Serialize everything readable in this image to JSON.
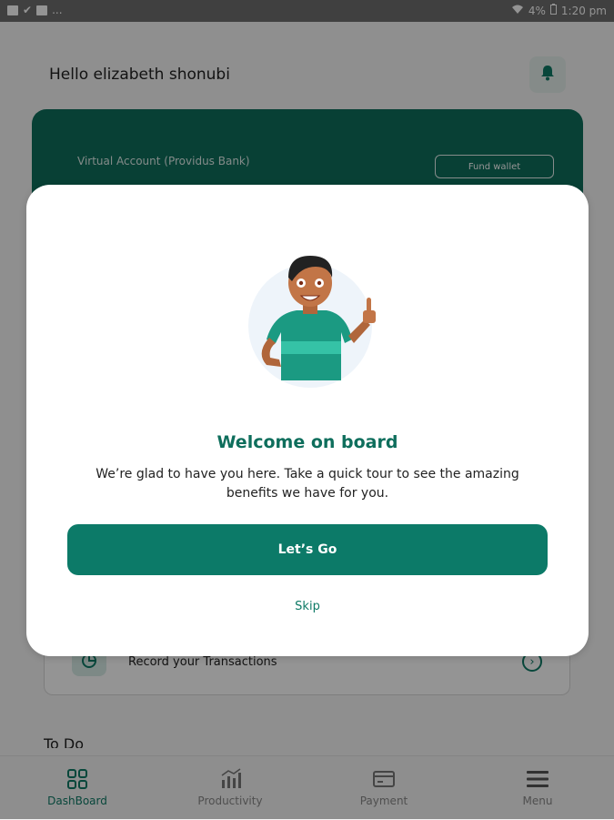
{
  "status_bar": {
    "left_more": "...",
    "battery": "4%",
    "time": "1:20 pm"
  },
  "header": {
    "greeting": "Hello elizabeth shonubi"
  },
  "account_card": {
    "account_label": "Virtual Account (Providus Bank)",
    "fund_button": "Fund wallet"
  },
  "record": {
    "label": "Record your Transactions"
  },
  "todo": {
    "title": "To Do"
  },
  "nav": {
    "items": [
      {
        "label": "DashBoard"
      },
      {
        "label": "Productivity"
      },
      {
        "label": "Payment"
      },
      {
        "label": "Menu"
      }
    ]
  },
  "modal": {
    "title": "Welcome on board",
    "text": "We’re glad to have you here. Take a quick tour to see the amazing benefits we have for you.",
    "primary_button": "Let’s Go",
    "skip": "Skip"
  },
  "colors": {
    "brand": "#0c7a68",
    "brand_dark": "#0e6e5c"
  }
}
